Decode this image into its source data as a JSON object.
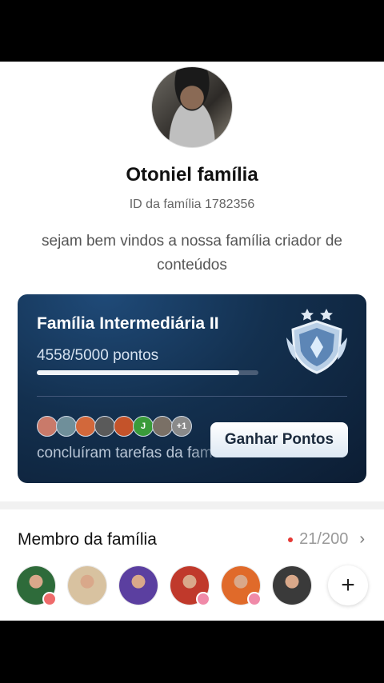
{
  "family": {
    "name": "Otoniel família",
    "id_text": "ID da família 1782356",
    "description": "sejam bem vindos a nossa família criador de conteúdos"
  },
  "level": {
    "title": "Família Intermediária II",
    "points_text": "4558/5000 pontos",
    "progress": 0.9116,
    "tasks_text": "concluíram tarefas da fam",
    "earn_button": "Ganhar Pontos",
    "badge_icon": "shield-badge-icon",
    "mini_avatars": [
      {
        "color": "#c97a6a"
      },
      {
        "color": "#6f8f9a"
      },
      {
        "color": "#d2683b"
      },
      {
        "color": "#5a5a5a"
      },
      {
        "color": "#c4532a"
      },
      {
        "color": "#3a9b3a",
        "initial": "J"
      },
      {
        "color": "#7a7066"
      },
      {
        "color": "#8a8a8a",
        "initial": "+1"
      }
    ]
  },
  "members": {
    "title": "Membro da família",
    "count": "21/200",
    "avatars": [
      {
        "color": "#2e6b3a",
        "badge": "red"
      },
      {
        "color": "#d8c2a0"
      },
      {
        "color": "#5b3fa0"
      },
      {
        "color": "#c0392b",
        "badge": "pink"
      },
      {
        "color": "#e06a2a",
        "badge": "pink"
      },
      {
        "color": "#3a3a3a"
      }
    ],
    "add_label": "+"
  },
  "colors": {
    "card_bg": "#13304f",
    "accent_red": "#e53935"
  }
}
